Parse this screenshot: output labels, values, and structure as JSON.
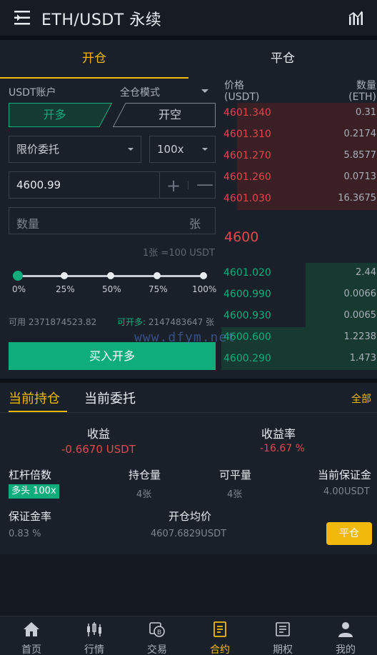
{
  "header": {
    "title": "ETH/USDT 永续",
    "menu_icon": "menu-icon",
    "chart_icon": "chart-icon"
  },
  "trade_tabs": [
    {
      "label": "开仓",
      "active": true
    },
    {
      "label": "平仓",
      "active": false
    }
  ],
  "order_form": {
    "account_label": "USDT账户",
    "margin_mode": "全仓模式",
    "side_long": "开多",
    "side_short": "开空",
    "order_type": "限价委托",
    "leverage": "100x",
    "price_value": "4600.99",
    "plus_label": "+",
    "minus_label": "—",
    "quantity_placeholder": "数量",
    "quantity_unit": "张",
    "lot_info": "1张 =100 USDT",
    "slider_marks": [
      "0%",
      "25%",
      "50%",
      "75%",
      "100%"
    ],
    "slider_value_percent": 0,
    "available_label": "可用",
    "available_value": "2371874523.82",
    "can_open_label": "可开多:",
    "can_open_value": "2147483647 张",
    "submit_label": "买入开多"
  },
  "orderbook": {
    "price_header": "价格",
    "price_unit": "(USDT)",
    "qty_header": "数量",
    "qty_unit": "(ETH)",
    "asks": [
      {
        "price": "4601.340",
        "qty": "0.31",
        "depth": 0.9
      },
      {
        "price": "4601.310",
        "qty": "0.2174",
        "depth": 0.9
      },
      {
        "price": "4601.270",
        "qty": "5.8577",
        "depth": 0.9
      },
      {
        "price": "4601.260",
        "qty": "0.0713",
        "depth": 0.9
      },
      {
        "price": "4601.030",
        "qty": "16.3675",
        "depth": 0.9
      }
    ],
    "last_price": "4600",
    "bids": [
      {
        "price": "4601.020",
        "qty": "2.44",
        "depth": 0.46
      },
      {
        "price": "4600.990",
        "qty": "0.0066",
        "depth": 0.46
      },
      {
        "price": "4600.930",
        "qty": "0.0065",
        "depth": 0.46
      },
      {
        "price": "4600.600",
        "qty": "1.2238",
        "depth": 1.0
      },
      {
        "price": "4600.290",
        "qty": "1.473",
        "depth": 1.0
      }
    ]
  },
  "watermark": "www.dfym.net",
  "positions": {
    "tab_positions": "当前持仓",
    "tab_orders": "当前委托",
    "all_label": "全部",
    "pnl_label": "收益",
    "pnl_value": "-0.6670 USDT",
    "roe_label": "收益率",
    "roe_value": "-16.67 %",
    "leverage_label": "杠杆倍数",
    "leverage_badge": "多头 100x",
    "holding_label": "持仓量",
    "holding_value": "4张",
    "closable_label": "可平量",
    "closable_value": "4张",
    "margin_label": "当前保证金",
    "margin_value": "4.00USDT",
    "margin_rate_label": "保证金率",
    "margin_rate_value": "0.83 %",
    "avg_price_label": "开仓均价",
    "avg_price_value": "4607.6829USDT",
    "close_button": "平仓"
  },
  "bottom_nav": [
    {
      "label": "首页",
      "icon": "home-icon",
      "active": false
    },
    {
      "label": "行情",
      "icon": "candlestick-icon",
      "active": false
    },
    {
      "label": "交易",
      "icon": "exchange-icon",
      "active": false
    },
    {
      "label": "合约",
      "icon": "contract-icon",
      "active": true
    },
    {
      "label": "期权",
      "icon": "options-icon",
      "active": false
    },
    {
      "label": "我的",
      "icon": "user-icon",
      "active": false
    }
  ],
  "colors": {
    "accent": "#f0b90b",
    "buy": "#0ead7b",
    "sell": "#e0484b",
    "background": "#1a202a"
  }
}
